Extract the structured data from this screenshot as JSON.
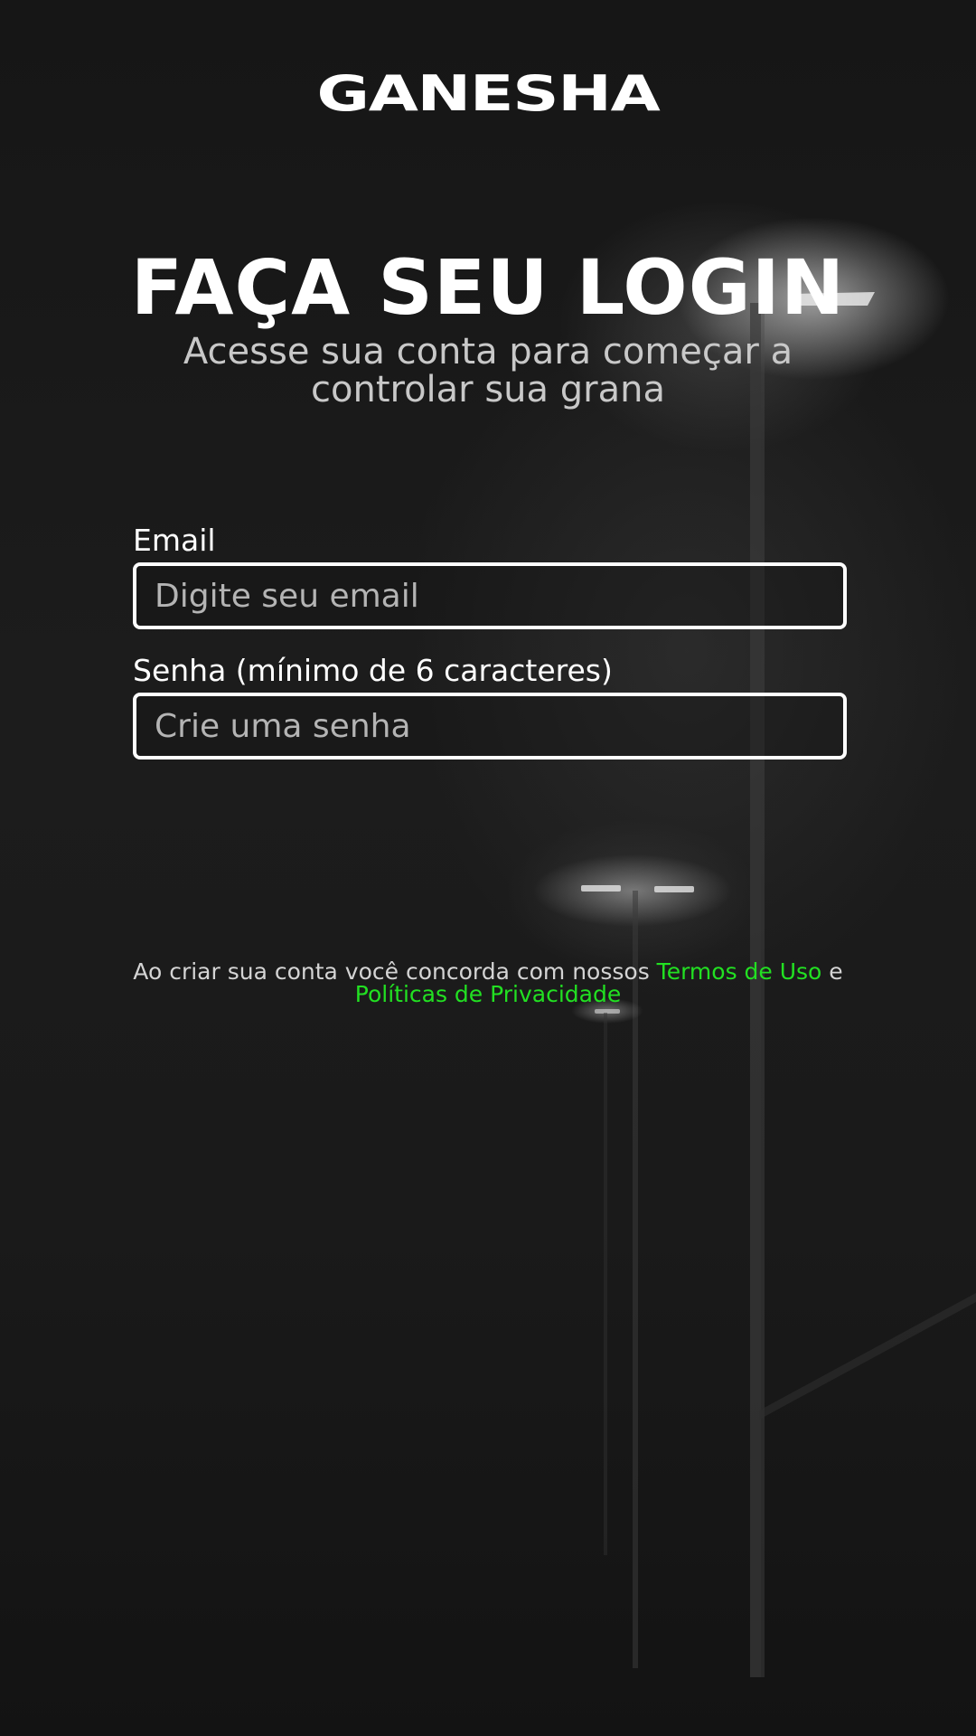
{
  "app": {
    "logo_text": "GANESHA"
  },
  "header": {
    "title": "FAÇA SEU LOGIN",
    "subtitle": "Acesse sua conta para começar a controlar sua grana"
  },
  "form": {
    "email": {
      "label": "Email",
      "placeholder": "Digite seu email",
      "value": ""
    },
    "password": {
      "label": "Senha (mínimo de 6 caracteres)",
      "placeholder": "Crie uma senha",
      "value": ""
    }
  },
  "footer": {
    "terms_prefix": "Ao criar sua conta você concorda com nossos ",
    "terms_link": "Termos de Uso",
    "terms_connector": " e ",
    "privacy_link": "Políticas de Privacidade"
  },
  "colors": {
    "background": "#141414",
    "text": "#ffffff",
    "subtitle_text": "#c8c8c8",
    "link_accent": "#22e022",
    "input_border": "#ffffff"
  }
}
